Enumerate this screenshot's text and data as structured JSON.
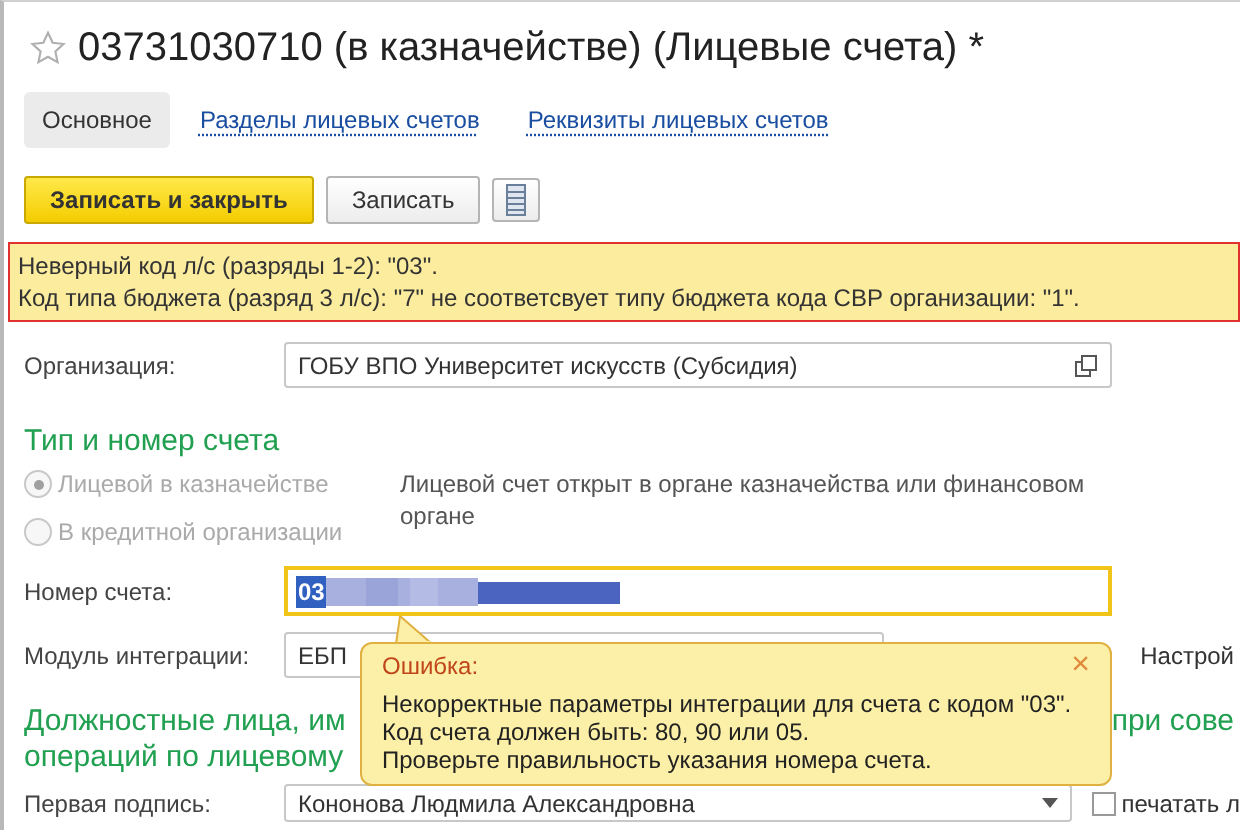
{
  "title": "03731030710 (в казначействе) (Лицевые счета) *",
  "tabs": [
    {
      "label": "Основное",
      "selected": true
    },
    {
      "label": "Разделы лицевых счетов",
      "selected": false
    },
    {
      "label": "Реквизиты лицевых счетов",
      "selected": false
    }
  ],
  "toolbar": [
    {
      "label": "Записать и закрыть",
      "kind": "primary"
    },
    {
      "label": "Записать",
      "kind": "default"
    }
  ],
  "errors": [
    "Неверный код л/с (разряды 1-2): \"03\".",
    "Код типа бюджета (разряд 3  л/с): \"7\" не соответсвует типу бюджета кода СВР организации: \"1\"."
  ],
  "organization": {
    "label": "Организация:",
    "value": "ГОБУ ВПО Университет искусств (Субсидия)"
  },
  "account_section": {
    "heading": "Тип и номер счета",
    "options": [
      {
        "label": "Лицевой в казначействе",
        "selected": true,
        "disabled": true
      },
      {
        "label": "В кредитной организации",
        "selected": false,
        "disabled": true
      }
    ],
    "note": "Лицевой счет открыт в органе казначейства или финансовом органе"
  },
  "account_number": {
    "label": "Номер счета:",
    "value": "03"
  },
  "integration": {
    "label": "Модуль интеграции:",
    "value": "ЕБП",
    "side_label": "Настрой"
  },
  "officials": {
    "heading_left": "Должностные лица, им",
    "heading_right": "при сове",
    "heading_line_2": "операций по лицевому"
  },
  "first_signature": {
    "label": "Первая подпись:",
    "value": "Кононова Людмила Александровна",
    "side_label": "печатать л",
    "checked": false
  },
  "tooltip": {
    "title": "Ошибка:",
    "close": "×",
    "lines": [
      "Некорректные параметры интеграции для счета с кодом \"03\".",
      "Код счета должен быть: 80, 90 или 05.",
      "Проверьте правильность указания номера счета."
    ]
  }
}
